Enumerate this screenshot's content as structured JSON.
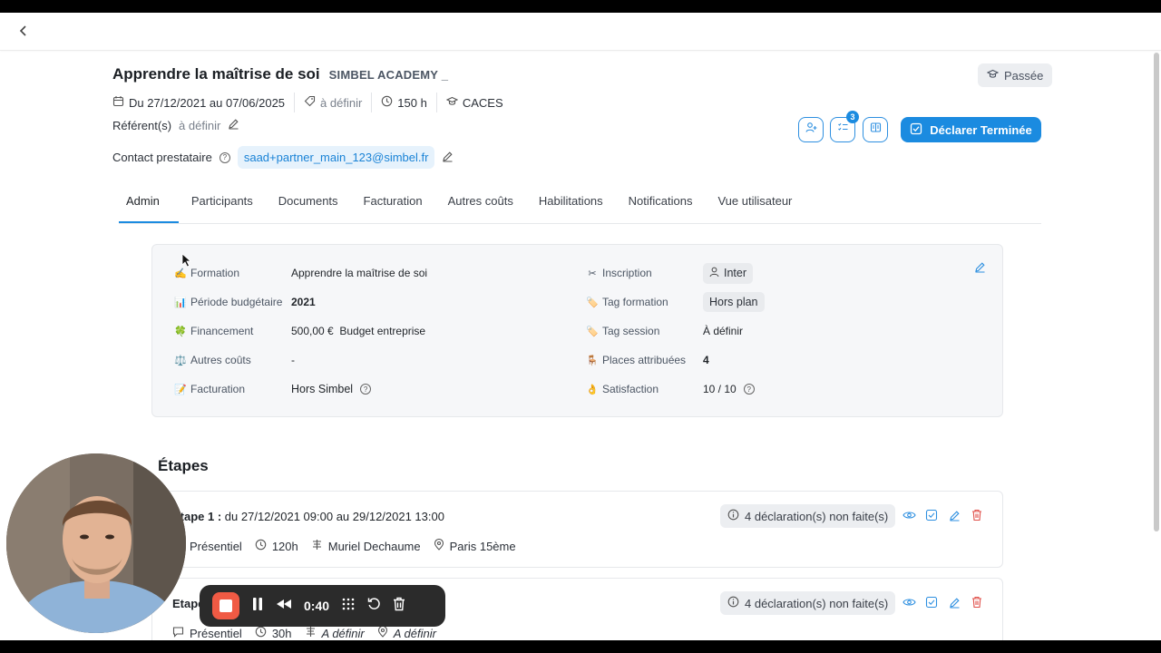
{
  "header": {
    "title": "Apprendre la maîtrise de soi",
    "provider": "SIMBEL ACADEMY _",
    "status": "Passée",
    "dates": "Du 27/12/2021 au 07/06/2025",
    "price": "à définir",
    "duration": "150 h",
    "category": "CACES",
    "referents_label": "Référent(s)",
    "referents_value": "à définir",
    "contact_label": "Contact prestataire",
    "contact_email": "saad+partner_main_123@simbel.fr",
    "badge_count": "3",
    "primary_action": "Déclarer Terminée"
  },
  "tabs": [
    "Admin",
    "Participants",
    "Documents",
    "Facturation",
    "Autres coûts",
    "Habilitations",
    "Notifications",
    "Vue utilisateur"
  ],
  "details": {
    "left": [
      {
        "icon": "✍️",
        "label": "Formation",
        "value": "Apprendre la maîtrise de soi"
      },
      {
        "icon": "📊",
        "label": "Période budgétaire",
        "value": "2021"
      },
      {
        "icon": "🍀",
        "label": "Financement",
        "value": "500,00 €  Budget entreprise"
      },
      {
        "icon": "⚖️",
        "label": "Autres coûts",
        "value": "-"
      },
      {
        "icon": "📝",
        "label": "Facturation",
        "value": "Hors Simbel"
      }
    ],
    "right": [
      {
        "icon": "✂",
        "label": "Inscription",
        "value": "Inter"
      },
      {
        "icon": "🏷️",
        "label": "Tag formation",
        "value": "Hors plan"
      },
      {
        "icon": "🏷️",
        "label": "Tag session",
        "value": "À définir"
      },
      {
        "icon": "🪑",
        "label": "Places attribuées",
        "value": "4"
      },
      {
        "icon": "👌",
        "label": "Satisfaction",
        "value": "10 / 10"
      }
    ]
  },
  "steps_title": "Étapes",
  "steps": [
    {
      "head_label": "Etape 1 :",
      "head_text": " du 27/12/2021 09:00 au 29/12/2021 13:00",
      "declarations": "4 déclaration(s) non faite(s)",
      "mode": "Présentiel",
      "hours": "120h",
      "trainer": "Muriel Dechaume",
      "location": "Paris 15ème"
    },
    {
      "head_label": "Etape",
      "head_text": "",
      "declarations": "4 déclaration(s) non faite(s)",
      "mode": "Présentiel",
      "hours": "30h",
      "trainer": "A définir",
      "location": "A définir"
    }
  ],
  "recorder": {
    "time": "0:40"
  },
  "colors": {
    "accent": "#1b8be0",
    "danger": "#e0504a",
    "stop": "#f05a44"
  }
}
